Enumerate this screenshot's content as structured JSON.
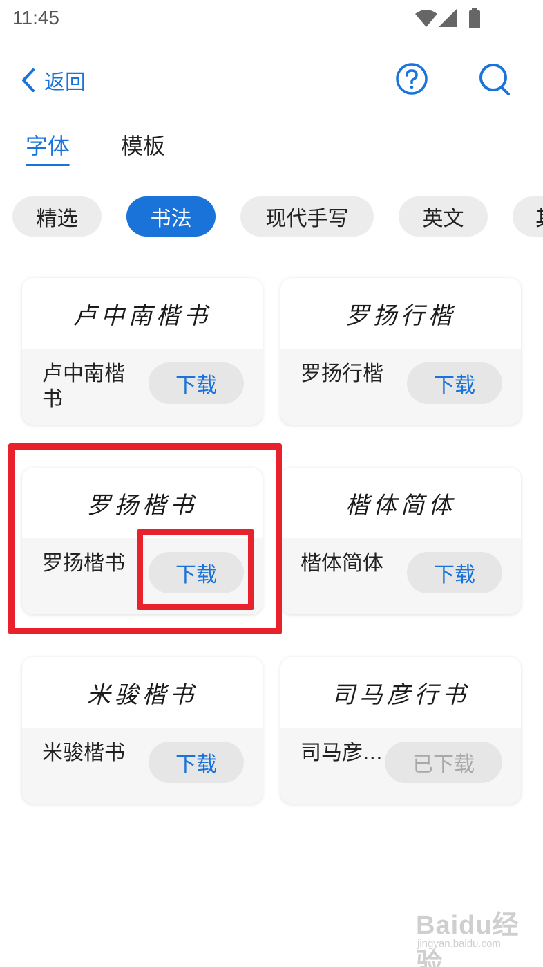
{
  "status_bar": {
    "time": "11:45",
    "icons": [
      "wifi-icon",
      "cellular-signal-icon",
      "battery-icon"
    ]
  },
  "header": {
    "back_label": "返回",
    "icons": [
      "chevron-left-icon",
      "help-icon",
      "search-icon"
    ]
  },
  "tabs": [
    {
      "label": "字体",
      "active": true
    },
    {
      "label": "模板",
      "active": false
    }
  ],
  "categories": [
    {
      "label": "精选",
      "active": false
    },
    {
      "label": "书法",
      "active": true
    },
    {
      "label": "现代手写",
      "active": false
    },
    {
      "label": "英文",
      "active": false
    },
    {
      "label": "其",
      "active": false
    }
  ],
  "fonts": [
    {
      "preview": "卢中南楷书",
      "name": "卢中南楷书",
      "action": "下载",
      "downloaded": false
    },
    {
      "preview": "罗扬行楷",
      "name": "罗扬行楷",
      "action": "下载",
      "downloaded": false
    },
    {
      "preview": "罗扬楷书",
      "name": "罗扬楷书",
      "action": "下载",
      "downloaded": false
    },
    {
      "preview": "楷体简体",
      "name": "楷体简体",
      "action": "下载",
      "downloaded": false
    },
    {
      "preview": "米骏楷书",
      "name": "米骏楷书",
      "action": "下载",
      "downloaded": false
    },
    {
      "preview": "司马彦行书",
      "name": "司马彦...",
      "action": "已下载",
      "downloaded": true
    }
  ],
  "annotations": {
    "highlight_color": "#e8212d"
  },
  "watermark": {
    "main": "Baidu经验",
    "sub": "jingyan.baidu.com"
  },
  "colors": {
    "accent": "#1a73d9",
    "chip_bg": "#ececec",
    "button_bg": "#e6e6e6",
    "disabled_text": "#a8a8a8"
  }
}
